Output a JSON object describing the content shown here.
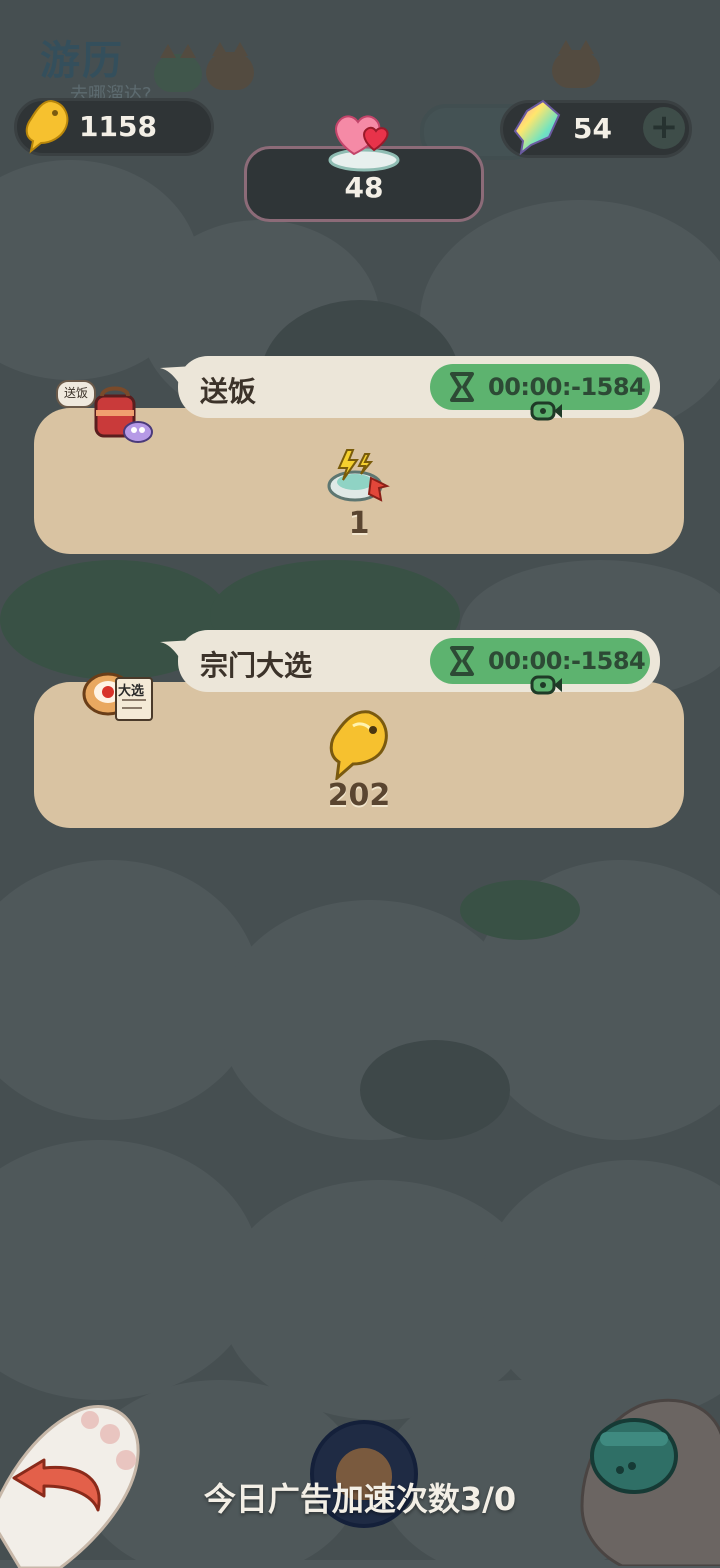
{
  "header": {
    "title": "游历",
    "subtitle": "去哪溜达?"
  },
  "currencies": {
    "fish_count": "1158",
    "gem_count": "54",
    "energy_count": "48",
    "fish_icon": "golden-fish-icon",
    "gem_icon": "crystal-fish-icon",
    "energy_icon": "hearts-icon"
  },
  "tasks": [
    {
      "name": "送饭",
      "badge": "送饭",
      "timer": "00:00:-1584",
      "reward_icon": "lightning-dish-icon",
      "reward_amount": "1"
    },
    {
      "name": "宗门大选",
      "badge": "大选",
      "timer": "00:00:-1584",
      "reward_icon": "golden-fish-icon",
      "reward_amount": "202"
    }
  ],
  "footer": {
    "ad_speedup": "今日广告加速次数3/0"
  },
  "colors": {
    "timer_green": "#5db36f",
    "card_tan": "#d9c3a2",
    "tab_cream": "#ece6d9",
    "back_arrow": "#e3604a"
  }
}
